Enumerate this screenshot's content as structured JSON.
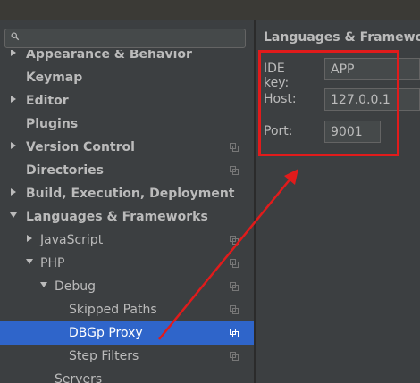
{
  "search": {
    "value": "",
    "icon": "search-icon"
  },
  "tree": [
    {
      "label": "Appearance & Behavior",
      "bold": true,
      "expander": "collapsed",
      "has_copy_icon": false
    },
    {
      "label": "Keymap",
      "bold": true,
      "expander": "none",
      "has_copy_icon": false
    },
    {
      "label": "Editor",
      "bold": true,
      "expander": "collapsed",
      "has_copy_icon": false
    },
    {
      "label": "Plugins",
      "bold": true,
      "expander": "none",
      "has_copy_icon": false
    },
    {
      "label": "Version Control",
      "bold": true,
      "expander": "collapsed",
      "has_copy_icon": true
    },
    {
      "label": "Directories",
      "bold": true,
      "expander": "none",
      "has_copy_icon": true
    },
    {
      "label": "Build, Execution, Deployment",
      "bold": true,
      "expander": "collapsed",
      "has_copy_icon": false
    },
    {
      "label": "Languages & Frameworks",
      "bold": true,
      "expander": "expanded",
      "has_copy_icon": false
    },
    {
      "label": "JavaScript",
      "bold": false,
      "expander": "collapsed",
      "has_copy_icon": true
    },
    {
      "label": "PHP",
      "bold": false,
      "expander": "expanded",
      "has_copy_icon": true
    },
    {
      "label": "Debug",
      "bold": false,
      "expander": "expanded",
      "has_copy_icon": true
    },
    {
      "label": "Skipped Paths",
      "bold": false,
      "expander": "none",
      "has_copy_icon": true
    },
    {
      "label": "DBGp Proxy",
      "bold": false,
      "expander": "none",
      "has_copy_icon": true,
      "selected": true
    },
    {
      "label": "Step Filters",
      "bold": false,
      "expander": "none",
      "has_copy_icon": true
    },
    {
      "label": "Servers",
      "bold": false,
      "expander": "none",
      "has_copy_icon": false
    }
  ],
  "panel": {
    "title": "Languages & Frameworks",
    "fields": [
      {
        "label": "IDE key:",
        "value": "APP"
      },
      {
        "label": "Host:",
        "value": "127.0.0.1"
      },
      {
        "label": "Port:",
        "value": "9001"
      }
    ]
  },
  "colors": {
    "background": "#3c3f41",
    "selection": "#2f65ca",
    "annotation": "#e11b1b",
    "text": "#bbbbbb"
  }
}
